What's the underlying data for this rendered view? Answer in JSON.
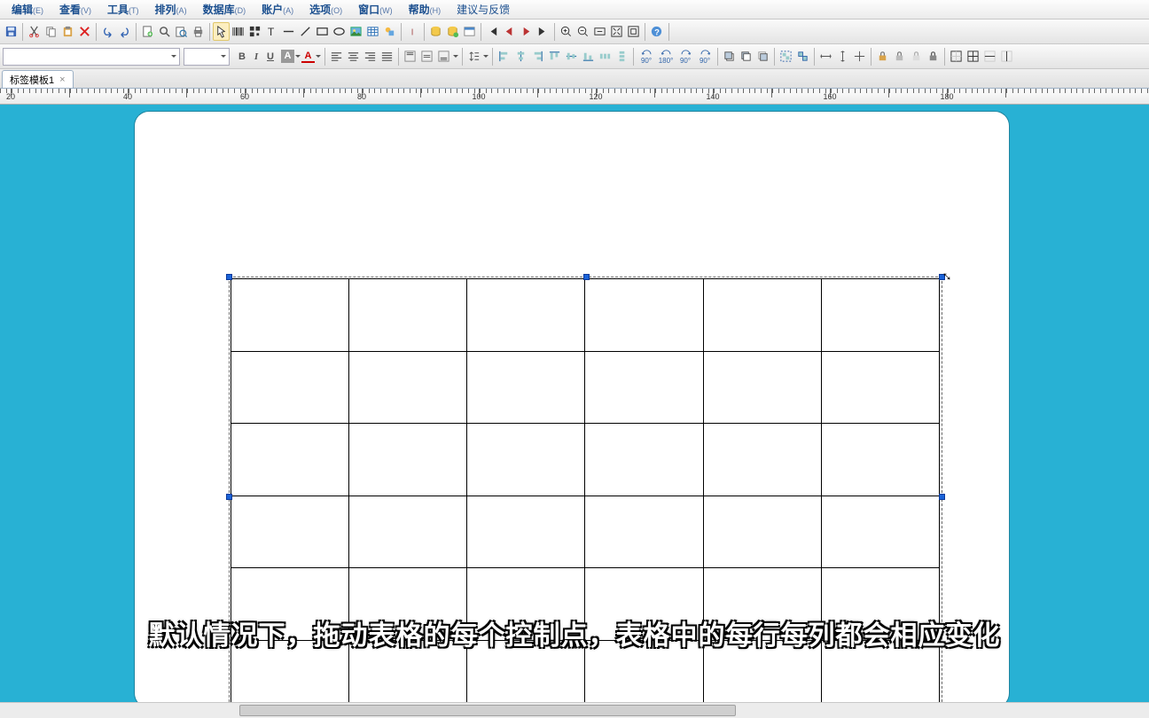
{
  "menu": {
    "edit": "编辑",
    "edit_s": "(E)",
    "view": "查看",
    "view_s": "(V)",
    "tool": "工具",
    "tool_s": "(T)",
    "arrange": "排列",
    "arrange_s": "(A)",
    "database": "数据库",
    "database_s": "(D)",
    "account": "账户",
    "account_s": "(A)",
    "options": "选项",
    "options_s": "(O)",
    "window": "窗口",
    "window_s": "(W)",
    "help": "帮助",
    "help_s": "(H)",
    "feedback": "建议与反馈"
  },
  "tab": {
    "name": "标签模板1"
  },
  "format": {
    "bold": "B",
    "italic": "I",
    "underline": "U",
    "abg": "A",
    "afg": "A"
  },
  "rotate": {
    "r1": "90°",
    "r2": "180°",
    "r3": "90°",
    "r4": "90°"
  },
  "ruler": {
    "start": 20,
    "step": 20,
    "count": 8,
    "pixelsPer10": 66
  },
  "table": {
    "rows": 6,
    "cols": 6
  },
  "caption": "默认情况下，拖动表格的每个控制点，表格中的每行每列都会相应变化"
}
